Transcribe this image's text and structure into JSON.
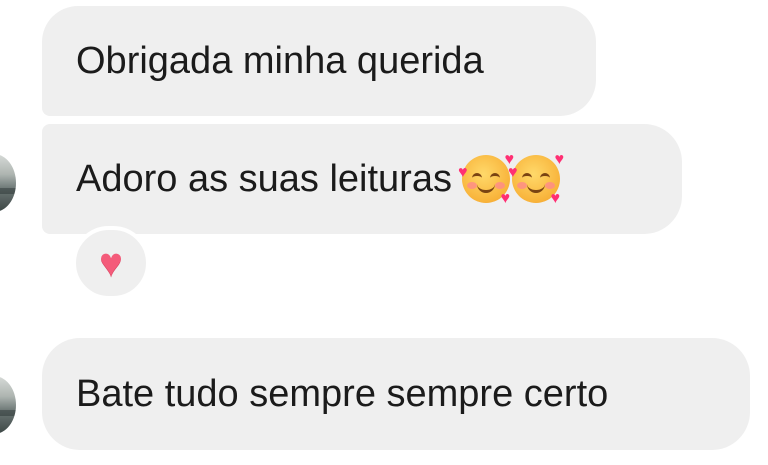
{
  "messages": [
    {
      "text": "Obrigada minha querida"
    },
    {
      "text": "Adoro as suas leituras",
      "emojis": [
        "smiling-face-with-hearts",
        "smiling-face-with-hearts"
      ]
    },
    {
      "text": "Bate tudo sempre sempre certo"
    }
  ],
  "reaction": {
    "emoji": "heart",
    "glyph": "♥"
  },
  "colors": {
    "bubble": "#efefef",
    "text": "#1b1b1b",
    "heart": "#f45b7a"
  }
}
